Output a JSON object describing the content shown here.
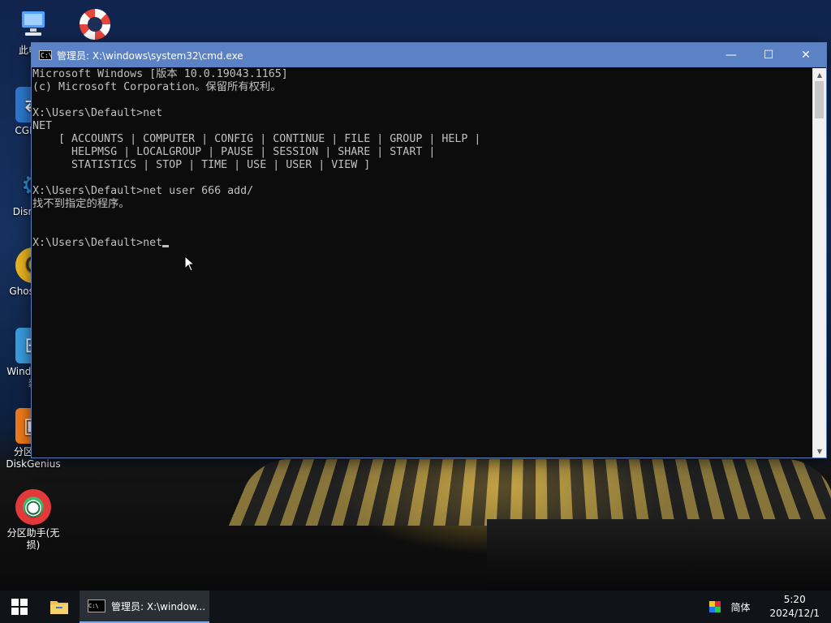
{
  "desktop": {
    "icons": [
      {
        "label": "此电脑",
        "icon": "computer-icon"
      },
      {
        "label": "",
        "icon": "lifebuoy-icon"
      },
      {
        "label": "CGI备份",
        "icon": "cgi-backup-icon"
      },
      {
        "label": "Dism++",
        "icon": "gear-icon"
      },
      {
        "label": "Ghost浏览",
        "icon": "ghost-icon"
      },
      {
        "label": "Windows安装",
        "icon": "windows-installer-icon"
      },
      {
        "label": "分区工具DiskGenius",
        "icon": "diskgenius-icon"
      },
      {
        "label": "分区助手(无损)",
        "icon": "partition-assistant-icon"
      }
    ]
  },
  "cmd_window": {
    "title": "管理员: X:\\windows\\system32\\cmd.exe",
    "controls": {
      "minimize": "—",
      "maximize": "☐",
      "close": "✕"
    },
    "console_lines": [
      "Microsoft Windows [版本 10.0.19043.1165]",
      "(c) Microsoft Corporation。保留所有权利。",
      "",
      "X:\\Users\\Default>net",
      "NET",
      "    [ ACCOUNTS | COMPUTER | CONFIG | CONTINUE | FILE | GROUP | HELP |",
      "      HELPMSG | LOCALGROUP | PAUSE | SESSION | SHARE | START |",
      "      STATISTICS | STOP | TIME | USE | USER | VIEW ]",
      "",
      "X:\\Users\\Default>net user 666 add/",
      "找不到指定的程序。",
      "",
      "",
      "X:\\Users\\Default>net"
    ]
  },
  "taskbar": {
    "task_label": "管理员: X:\\window...",
    "ime_label": "简体",
    "time": "5:20",
    "date": "2024/12/1"
  }
}
